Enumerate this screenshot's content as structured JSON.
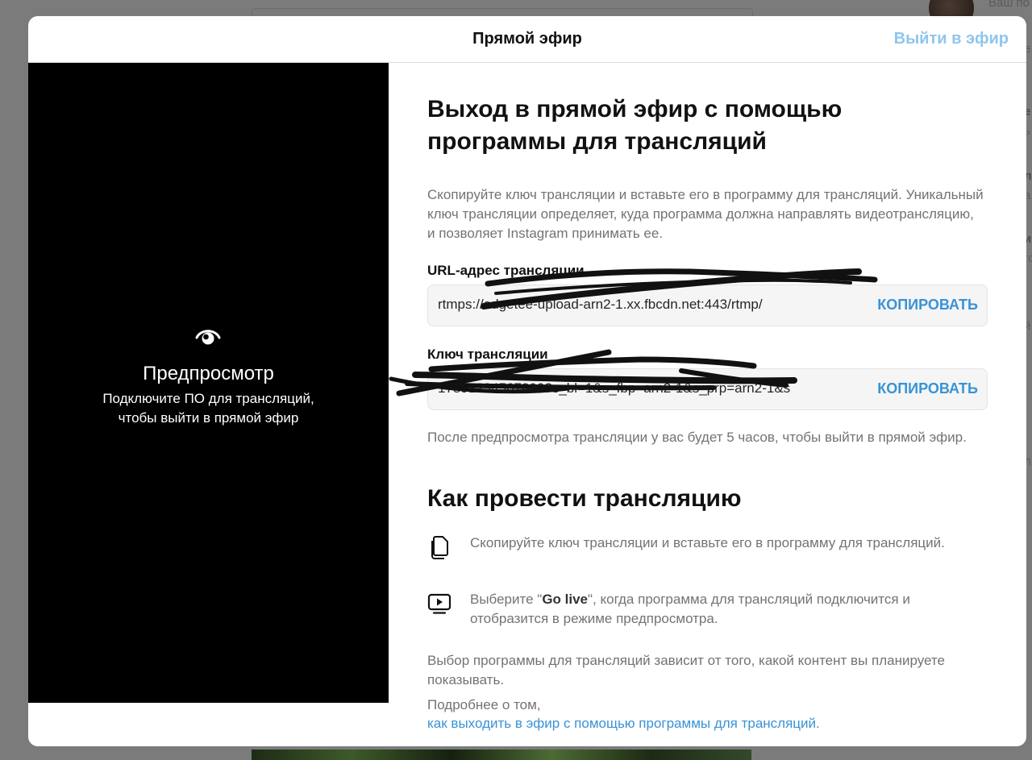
{
  "background": {
    "user_label": "Ваш по",
    "fragments": [
      "е",
      "е",
      "ь",
      "л",
      "а",
      "ип",
      "го",
      "й",
      "л"
    ]
  },
  "modal": {
    "title": "Прямой эфир",
    "go_live_label": "Выйти в эфир"
  },
  "preview": {
    "icon": "eye-icon",
    "title": "Предпросмотр",
    "subtitle": "Подключите ПО для трансляций, чтобы выйти в прямой эфир"
  },
  "main": {
    "heading": "Выход в прямой эфир с помощью программы для трансляций",
    "description": "Скопируйте ключ трансляции и вставьте его в программу для трансляций. Уникальный ключ трансляции определяет, куда программа должна направлять видеотрансляцию, и позволяет Instagram принимать ее.",
    "url_field": {
      "label": "URL-адрес трансляции",
      "value": "rtmps://edgetee-upload-arn2-1.xx.fbcdn.net:443/rtmp/",
      "copy_label": "КОПИРОВАТЬ"
    },
    "key_field": {
      "label": "Ключ трансляции",
      "value": "17891234567890?s_bl=1&s_fbp=arn2-1&s_prp=arn2-1&s",
      "copy_label": "КОПИРОВАТЬ"
    },
    "note": "После предпросмотра трансляции у вас будет 5 часов, чтобы выйти в прямой эфир."
  },
  "howto": {
    "heading": "Как провести трансляцию",
    "steps": [
      {
        "icon": "copy-icon",
        "text": "Скопируйте ключ трансляции и вставьте его в программу для трансляций."
      },
      {
        "icon": "live-screen-icon",
        "text_before": "Выберите \"",
        "text_bold": "Go live",
        "text_after": "\", когда программа для трансляций подключится и отобразится в режиме предпросмотра."
      }
    ],
    "choice_note": "Выбор программы для трансляций зависит от того, какой контент вы планируете показывать.",
    "more_prefix": "Подробнее о том,",
    "more_link": "как выходить в эфир с помощью программы для трансляций."
  }
}
